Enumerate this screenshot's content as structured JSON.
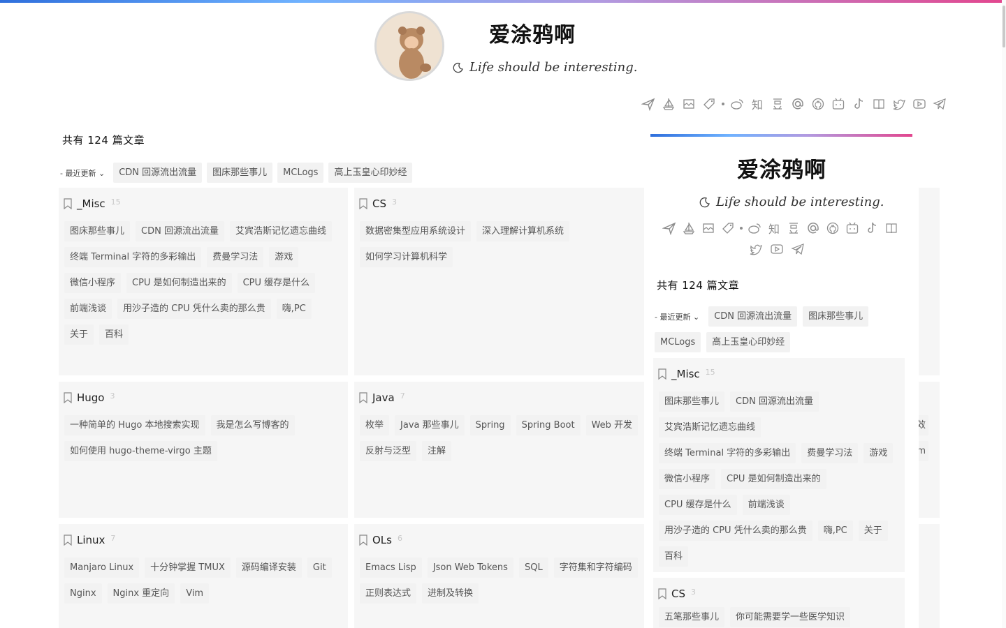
{
  "site": {
    "title": "爱涂鸦啊",
    "motto": "Life should be interesting."
  },
  "social_icons": [
    "send-icon",
    "sailboat-icon",
    "mail-icon",
    "tag-icon",
    "dot",
    "weibo-icon",
    "zhihu-icon",
    "douban-icon",
    "at-icon",
    "github-icon",
    "bilibili-icon",
    "tiktok-icon",
    "book-icon",
    "twitter-icon",
    "youtube-icon",
    "telegram-icon"
  ],
  "social_zhihu": "知",
  "total_text": "共有 124 篇文章",
  "recent": {
    "label": "- 最近更新 ⌄",
    "tags": [
      "CDN 回源流出流量",
      "图床那些事儿",
      "MCLogs",
      "高上玉皇心印妙经"
    ]
  },
  "categories": [
    {
      "name": "_Misc",
      "count": "15",
      "tags": [
        "图床那些事儿",
        "CDN 回源流出流量",
        "艾宾浩斯记忆遗忘曲线",
        "终端 Terminal 字符的多彩输出",
        "费曼学习法",
        "游戏",
        "微信小程序",
        "CPU 是如何制造出来的",
        "CPU 缓存是什么",
        "前端浅谈",
        "用沙子造的 CPU 凭什么卖的那么贵",
        "嗨,PC",
        "关于",
        "百科"
      ]
    },
    {
      "name": "CS",
      "count": "3",
      "tags": [
        "数据密集型应用系统设计",
        "深入理解计算机系统",
        "如何学习计算机科学"
      ]
    },
    {
      "name": "Hugo",
      "count": "3",
      "tags": [
        "一种简单的 Hugo 本地搜索实现",
        "我是怎么写博客的",
        "如何使用 hugo-theme-virgo 主题"
      ]
    },
    {
      "name": "Java",
      "count": "7",
      "tags": [
        "枚举",
        "Java 那些事儿",
        "Spring",
        "Spring Boot",
        "Web 开发",
        "反射与泛型",
        "注解"
      ]
    },
    {
      "name": "Linux",
      "count": "7",
      "tags": [
        "Manjaro Linux",
        "十分钟掌握 TMUX",
        "源码编译安装",
        "Git",
        "Nginx",
        "Nginx 重定向",
        "Vim"
      ]
    },
    {
      "name": "OLs",
      "count": "6",
      "tags": [
        "Emacs Lisp",
        "Json Web Tokens",
        "SQL",
        "字符集和字符编码",
        "正则表达式",
        "进制及转换"
      ]
    }
  ],
  "peek_text": [
    "效",
    "m"
  ],
  "overlay": {
    "title": "爱涂鸦啊",
    "motto": "Life should be interesting.",
    "total_text": "共有 124 篇文章",
    "recent_label": "- 最近更新 ⌄",
    "recent_tags": [
      "CDN 回源流出流量",
      "图床那些事儿",
      "MCLogs",
      "高上玉皇心印妙经"
    ],
    "misc": {
      "name": "_Misc",
      "count": "15",
      "tags": [
        "图床那些事儿",
        "CDN 回源流出流量",
        "艾宾浩斯记忆遗忘曲线",
        "终端 Terminal 字符的多彩输出",
        "费曼学习法",
        "游戏",
        "微信小程序",
        "CPU 是如何制造出来的",
        "CPU 缓存是什么",
        "前端浅谈",
        "用沙子造的 CPU 凭什么卖的那么贵",
        "嗨,PC",
        "关于",
        "百科"
      ]
    },
    "cs": {
      "name": "CS",
      "count": "3",
      "tags": [
        "五笔那些事儿",
        "你可能需要学一些医学知识"
      ]
    }
  },
  "colors": {
    "gradient_start": "#2f6fdc",
    "gradient_end": "#e2478f",
    "tag_bg": "#f2f2f2",
    "card_bg": "#f6f6f6",
    "icon": "#8d8d8d"
  }
}
